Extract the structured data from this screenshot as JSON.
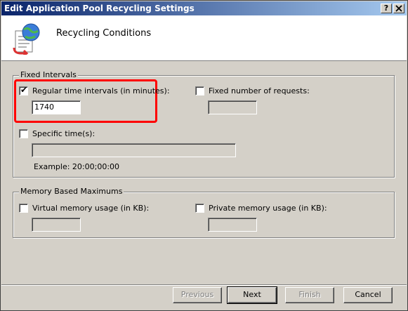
{
  "window": {
    "title": "Edit Application Pool Recycling Settings",
    "help_button": "?",
    "close_button": "X"
  },
  "header": {
    "title": "Recycling Conditions",
    "icon": "recycling-document-globe-icon"
  },
  "fixed_intervals": {
    "legend": "Fixed Intervals",
    "regular_time": {
      "label": "Regular time intervals (in minutes):",
      "checked": true,
      "value": "1740"
    },
    "fixed_requests": {
      "label": "Fixed number of requests:",
      "checked": false,
      "value": ""
    },
    "specific_times": {
      "label": "Specific time(s):",
      "checked": false,
      "value": "",
      "example": "Example: 20:00;00:00"
    }
  },
  "memory_maximums": {
    "legend": "Memory Based Maximums",
    "virtual_memory": {
      "label": "Virtual memory usage (in KB):",
      "checked": false,
      "value": ""
    },
    "private_memory": {
      "label": "Private memory usage (in KB):",
      "checked": false,
      "value": ""
    }
  },
  "buttons": {
    "previous": "Previous",
    "next": "Next",
    "finish": "Finish",
    "cancel": "Cancel"
  },
  "colors": {
    "title_bar": "#0a246a",
    "highlight": "#ff0000",
    "dialog_bg": "#d4d0c8"
  }
}
